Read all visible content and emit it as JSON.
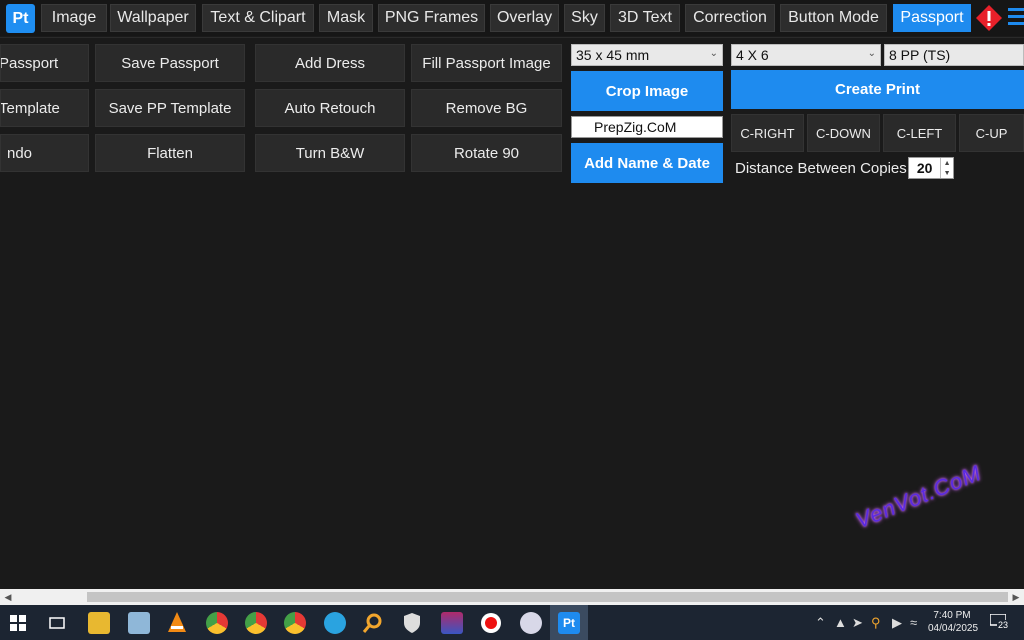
{
  "app": {
    "logo": "Pt",
    "tabs": [
      {
        "label": "Image",
        "active": false
      },
      {
        "label": "Wallpaper",
        "active": false
      },
      {
        "label": "Text & Clipart",
        "active": false
      },
      {
        "label": "Mask",
        "active": false
      },
      {
        "label": "PNG Frames",
        "active": false
      },
      {
        "label": "Overlay",
        "active": false
      },
      {
        "label": "Sky",
        "active": false
      },
      {
        "label": "3D Text",
        "active": false
      },
      {
        "label": "Correction",
        "active": false
      },
      {
        "label": "Button Mode",
        "active": false
      },
      {
        "label": "Passport",
        "active": true
      }
    ]
  },
  "toolbar": {
    "rows": [
      [
        "Passport",
        "Save Passport",
        "Add Dress",
        "Fill Passport Image"
      ],
      [
        "Template",
        "Save PP Template",
        "Auto Retouch",
        "Remove BG"
      ],
      [
        "ndo",
        "Flatten",
        "Turn B&W",
        "Rotate 90"
      ]
    ]
  },
  "crop": {
    "size_select": "35  x 45 mm",
    "crop_button": "Crop Image",
    "name_input": "PrepZig.CoM",
    "add_name_button": "Add Name & Date"
  },
  "print": {
    "paper_select": "4 X 6",
    "copies_select": "8 PP (TS)",
    "create_button": "Create Print",
    "direction_buttons": [
      "C-RIGHT",
      "C-DOWN",
      "C-LEFT",
      "C-UP"
    ],
    "distance_label": "Distance Between Copies :",
    "distance_value": "20"
  },
  "watermark": "VenVot.CoM",
  "taskbar": {
    "time": "7:40 PM",
    "date": "04/04/2025",
    "notification_count": "23",
    "active_app": "Pt"
  },
  "colors": {
    "accent": "#1e8bef",
    "background": "#1a1a1a",
    "button": "#2a2a2a"
  }
}
